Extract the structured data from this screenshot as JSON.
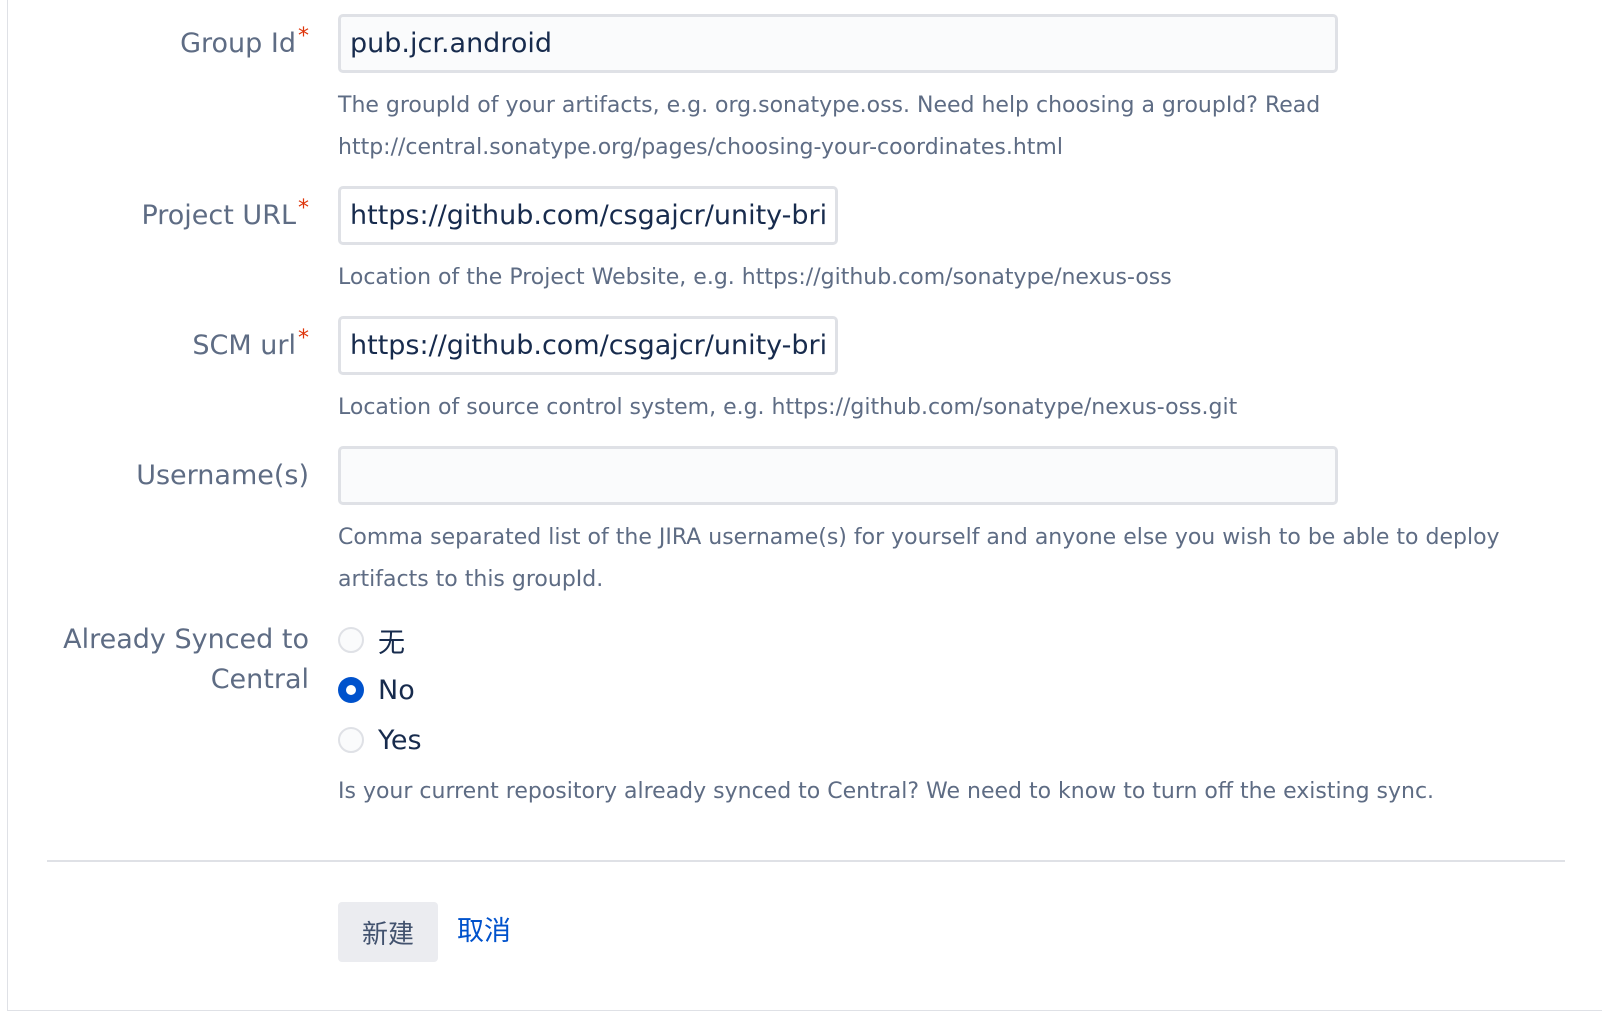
{
  "form": {
    "group_id": {
      "label": "Group Id",
      "required_mark": "*",
      "value": "pub.jcr.android",
      "help_line1": "The groupId of your artifacts, e.g. org.sonatype.oss. Need help choosing a groupId? Read",
      "help_line2": "http://central.sonatype.org/pages/choosing-your-coordinates.html"
    },
    "project_url": {
      "label": "Project URL",
      "required_mark": "*",
      "value": "https://github.com/csgajcr/unity-brid",
      "help": "Location of the Project Website, e.g. https://github.com/sonatype/nexus-oss"
    },
    "scm_url": {
      "label": "SCM url",
      "required_mark": "*",
      "value": "https://github.com/csgajcr/unity-brid",
      "help": "Location of source control system, e.g. https://github.com/sonatype/nexus-oss.git"
    },
    "usernames": {
      "label": "Username(s)",
      "value": "",
      "help_line1": "Comma separated list of the JIRA username(s) for yourself and anyone else you wish to be able to deploy",
      "help_line2": "artifacts to this groupId."
    },
    "already_synced": {
      "label_line1": "Already Synced to",
      "label_line2": "Central",
      "options": [
        {
          "label": "无",
          "checked": false
        },
        {
          "label": "No",
          "checked": true
        },
        {
          "label": "Yes",
          "checked": false
        }
      ],
      "help": "Is your current repository already synced to Central? We need to know to turn off the existing sync."
    }
  },
  "actions": {
    "create_label": "新建",
    "cancel_label": "取消"
  },
  "colors": {
    "accent": "#0052cc",
    "required": "#de350b",
    "label": "#5e6c84",
    "input_border": "#dfe1e6"
  }
}
